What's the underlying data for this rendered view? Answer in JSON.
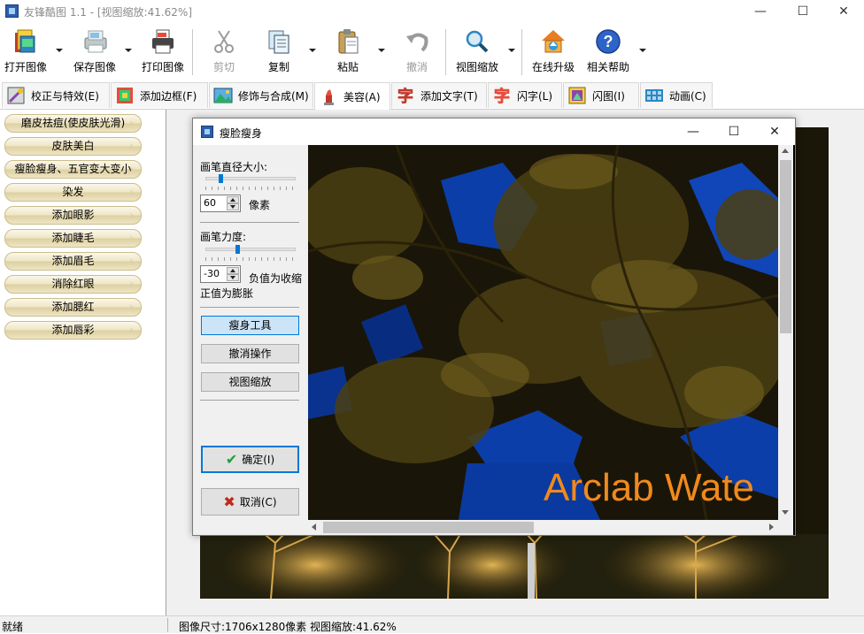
{
  "window": {
    "title": "友锋酷图 1.1 - [视图缩放:41.62%]",
    "minimize_glyph": "—",
    "maximize_glyph": "☐",
    "close_glyph": "✕"
  },
  "toolbar": {
    "open_label": "打开图像",
    "save_label": "保存图像",
    "print_label": "打印图像",
    "cut_label": "剪切",
    "copy_label": "复制",
    "paste_label": "粘贴",
    "undo_label": "撤消",
    "zoom_label": "视图缩放",
    "upgrade_label": "在线升级",
    "help_label": "相关帮助"
  },
  "tabs": [
    {
      "label": "校正与特效(E)",
      "icon": "correction-icon"
    },
    {
      "label": "添加边框(F)",
      "icon": "border-icon"
    },
    {
      "label": "修饰与合成(M)",
      "icon": "landscape-icon"
    },
    {
      "label": "美容(A)",
      "icon": "lipstick-icon"
    },
    {
      "label": "添加文字(T)",
      "icon": "text-char-icon"
    },
    {
      "label": "闪字(L)",
      "icon": "flash-text-icon"
    },
    {
      "label": "闪图(I)",
      "icon": "flash-image-icon"
    },
    {
      "label": "动画(C)",
      "icon": "film-icon"
    }
  ],
  "sidebar": {
    "items": [
      {
        "label": "磨皮祛痘(使皮肤光滑)"
      },
      {
        "label": "皮肤美白"
      },
      {
        "label": "瘦脸瘦身、五官变大变小"
      },
      {
        "label": "染发"
      },
      {
        "label": "添加眼影"
      },
      {
        "label": "添加睫毛"
      },
      {
        "label": "添加眉毛"
      },
      {
        "label": "消除红眼"
      },
      {
        "label": "添加腮红"
      },
      {
        "label": "添加唇彩"
      }
    ]
  },
  "dialog": {
    "title": "瘦脸瘦身",
    "brush_size_label": "画笔直径大小:",
    "brush_size_value": "60",
    "brush_size_unit": "像素",
    "brush_size_fraction": 0.15,
    "brush_force_label": "画笔力度:",
    "brush_force_value": "-30",
    "brush_force_hint_1": "负值为收缩",
    "brush_force_hint_2": "正值为膨胀",
    "brush_force_fraction": 0.35,
    "slim_tool_label": "瘦身工具",
    "undo_label": "撤消操作",
    "zoom_label": "视图缩放",
    "ok_label": "确定(I)",
    "cancel_label": "取消(C)",
    "watermark_text": "Arclab Wate"
  },
  "status": {
    "ready": "就绪",
    "info": "图像尺寸:1706x1280像素 视图缩放:41.62%"
  },
  "colors": {
    "accent": "#0078d7",
    "sidebar_button": "#efe6c6",
    "watermark": "#f08a1c",
    "sky": "#0b3ea8"
  }
}
